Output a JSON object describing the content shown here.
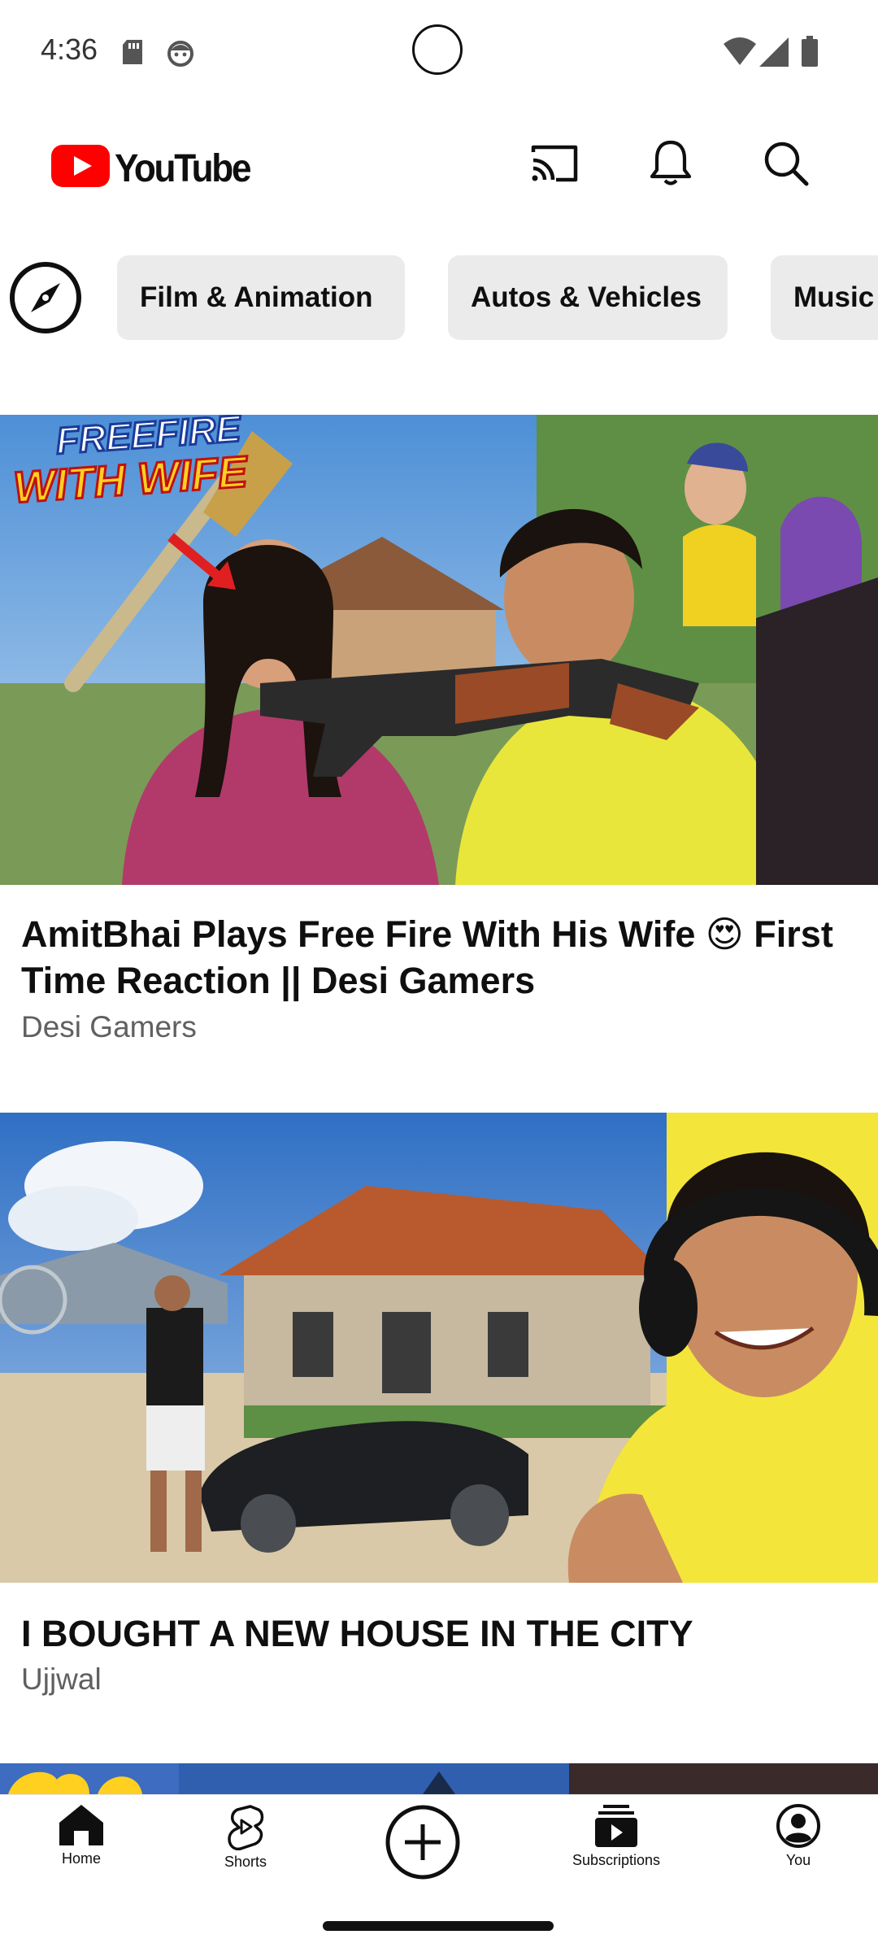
{
  "status_bar": {
    "time": "4:36",
    "icons": [
      "sd-card-icon",
      "face-icon",
      "wifi-icon",
      "signal-icon",
      "battery-icon"
    ]
  },
  "header": {
    "logo_text": "YouTube",
    "brand_color": "#ff0000",
    "actions": [
      "cast-icon",
      "bell-icon",
      "search-icon"
    ]
  },
  "chips": {
    "explore_icon": "compass-icon",
    "items": [
      "Film & Animation",
      "Autos & Vehicles",
      "Music"
    ]
  },
  "feed": [
    {
      "title": "AmitBhai Plays Free Fire With His Wife 😍 First Time Reaction || Desi Gamers",
      "channel": "Desi Gamers",
      "thumbnail_text": "FREEFIRE WITH WIFE"
    },
    {
      "title": "I BOUGHT A NEW HOUSE IN THE CITY",
      "channel": "Ujjwal"
    }
  ],
  "bottom_nav": {
    "items": [
      {
        "label": "Home",
        "icon": "home-icon"
      },
      {
        "label": "Shorts",
        "icon": "shorts-icon"
      },
      {
        "label": "",
        "icon": "create-icon"
      },
      {
        "label": "Subscriptions",
        "icon": "subscriptions-icon"
      },
      {
        "label": "You",
        "icon": "account-icon"
      }
    ]
  }
}
